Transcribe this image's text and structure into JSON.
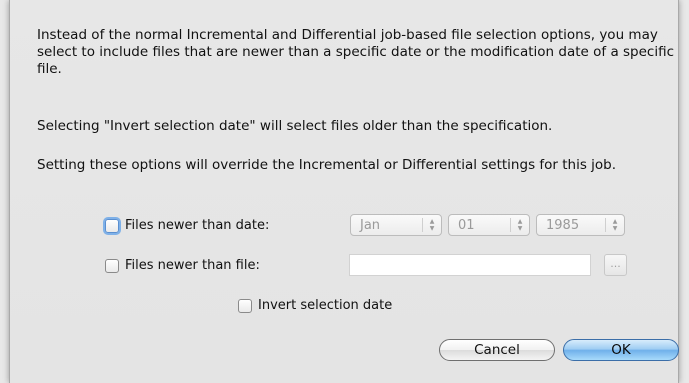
{
  "description": {
    "paragraph1": "Instead of the normal Incremental and Differential job-based file selection options, you may select to include files that are newer than a specific date or the modification date of a specific file.",
    "paragraph2": "Selecting \"Invert selection date\" will select files older than the specification.",
    "paragraph3": "Setting these options will override the Incremental or Differential settings for this job."
  },
  "options": {
    "newer_than_date": {
      "label": "Files newer than date:",
      "checked": false
    },
    "newer_than_file": {
      "label": "Files newer than file:",
      "checked": false,
      "value": "",
      "browse_label": "..."
    },
    "invert_selection": {
      "label": "Invert selection date",
      "checked": false
    }
  },
  "date": {
    "month": "Jan",
    "day": "01",
    "year": "1985"
  },
  "buttons": {
    "cancel": "Cancel",
    "ok": "OK"
  },
  "colors": {
    "dialog_bg": "#e6e6e6",
    "default_button": "#6fb0ea",
    "focus_ring": "#7fb1e8"
  }
}
